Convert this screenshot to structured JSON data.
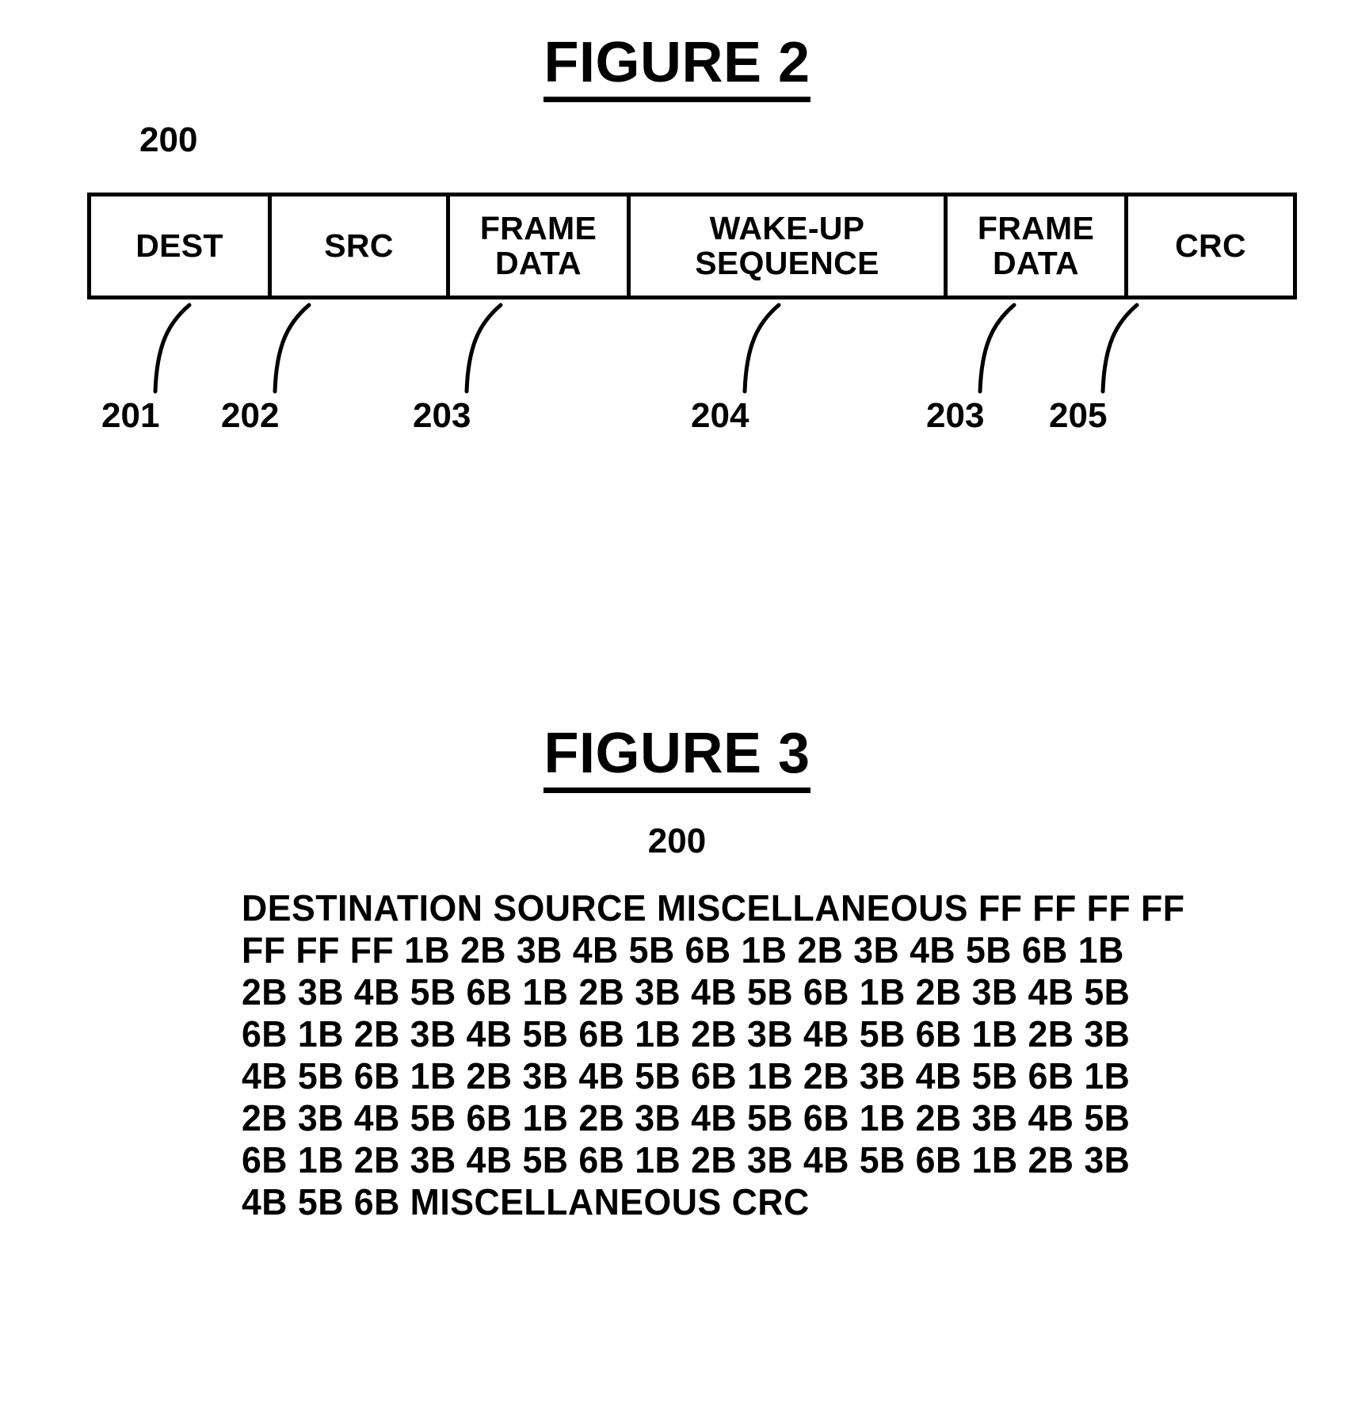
{
  "figure2": {
    "title": "FIGURE 2",
    "assembly_ref": "200",
    "frame_cells": [
      {
        "label": "DEST",
        "ref": "201"
      },
      {
        "label": "SRC",
        "ref": "202"
      },
      {
        "label": "FRAME\nDATA",
        "ref": "203"
      },
      {
        "label": "WAKE-UP\nSEQUENCE",
        "ref": "204"
      },
      {
        "label": "FRAME\nDATA",
        "ref": "203"
      },
      {
        "label": "CRC",
        "ref": "205"
      }
    ],
    "ref_labels": [
      "201",
      "202",
      "203",
      "204",
      "203",
      "205"
    ]
  },
  "figure3": {
    "title": "FIGURE 3",
    "assembly_ref": "200",
    "hex_lines": [
      "DESTINATION  SOURCE  MISCELLANEOUS  FF  FF  FF  FF",
      "FF  FF  FF  1B  2B  3B  4B  5B  6B  1B  2B  3B  4B  5B  6B  1B",
      "2B  3B  4B  5B  6B  1B  2B  3B  4B  5B  6B  1B  2B  3B  4B  5B",
      "6B  1B  2B  3B  4B  5B  6B  1B  2B  3B  4B  5B  6B  1B  2B  3B",
      "4B  5B  6B  1B  2B  3B  4B  5B  6B  1B  2B  3B  4B  5B  6B  1B",
      "2B  3B  4B  5B  6B  1B  2B  3B  4B  5B  6B  1B  2B  3B  4B  5B",
      "6B  1B  2B  3B  4B  5B  6B  1B  2B  3B  4B  5B  6B  1B  2B  3B",
      "4B  5B  6B  MISCELLANEOUS  CRC"
    ]
  },
  "colors": {
    "ink": "#000000",
    "paper": "#ffffff"
  }
}
